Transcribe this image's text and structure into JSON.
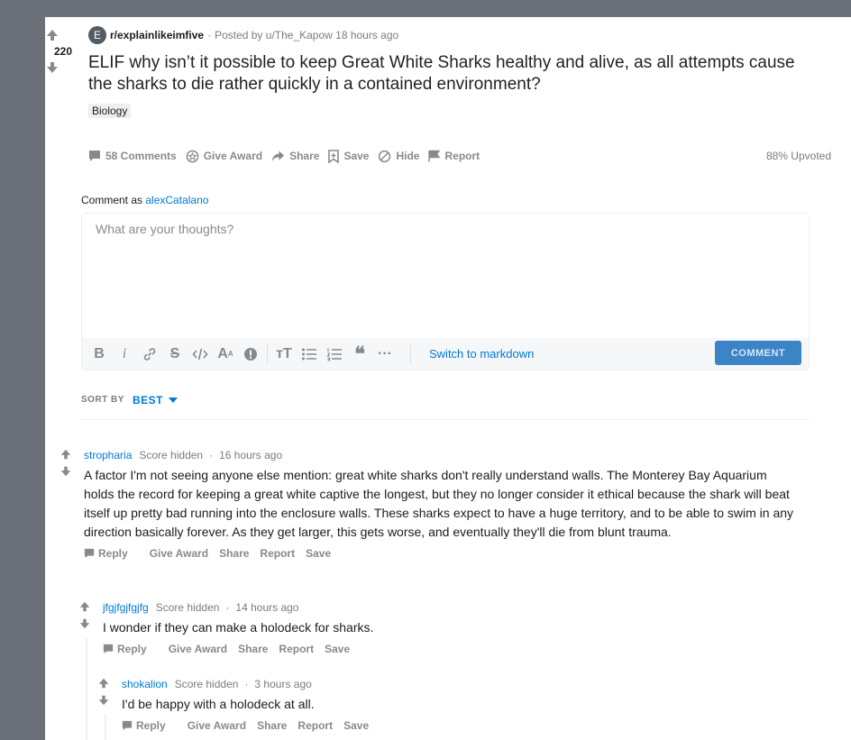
{
  "post": {
    "votes": "220",
    "subreddit_icon": "E",
    "subreddit": "r/explainlikeimfive",
    "posted_by": "Posted by u/The_Kapow 18 hours ago",
    "title": "ELIF why isn’t it possible to keep Great White Sharks healthy and alive, as all attempts cause the sharks to die rather quickly in a contained environment?",
    "flair": "Biology",
    "actions": {
      "comments": "58 Comments",
      "award": "Give Award",
      "share": "Share",
      "save": "Save",
      "hide": "Hide",
      "report": "Report"
    },
    "upvoted": "88% Upvoted"
  },
  "composer": {
    "comment_as_label": "Comment as",
    "username": "alexCatalano",
    "placeholder": "What are your thoughts?",
    "switch_markdown": "Switch to markdown",
    "submit_label": "COMMENT"
  },
  "sort": {
    "label": "SORT BY",
    "value": "BEST"
  },
  "comments": [
    {
      "author": "stropharia",
      "score": "Score hidden",
      "time": "16 hours ago",
      "body": "A factor I'm not seeing anyone else mention: great white sharks don't really understand walls. The Monterey Bay Aquarium holds the record for keeping a great white captive the longest, but they no longer consider it ethical because the shark will beat itself up pretty bad running into the enclosure walls. These sharks expect to have a huge territory, and to be able to swim in any direction basically forever. As they get larger, this gets worse, and eventually they'll die from blunt trauma."
    },
    {
      "author": "jfgjfgjfgjfg",
      "score": "Score hidden",
      "time": "14 hours ago",
      "body": "I wonder if they can make a holodeck for sharks."
    },
    {
      "author": "shokalion",
      "score": "Score hidden",
      "time": "3 hours ago",
      "body": "I'd be happy with a holodeck at all."
    }
  ],
  "comment_actions": {
    "reply": "Reply",
    "award": "Give Award",
    "share": "Share",
    "report": "Report",
    "save": "Save"
  },
  "colors": {
    "accent": "#0079d3",
    "button": "#3b84c6",
    "background": "#6b7079"
  }
}
